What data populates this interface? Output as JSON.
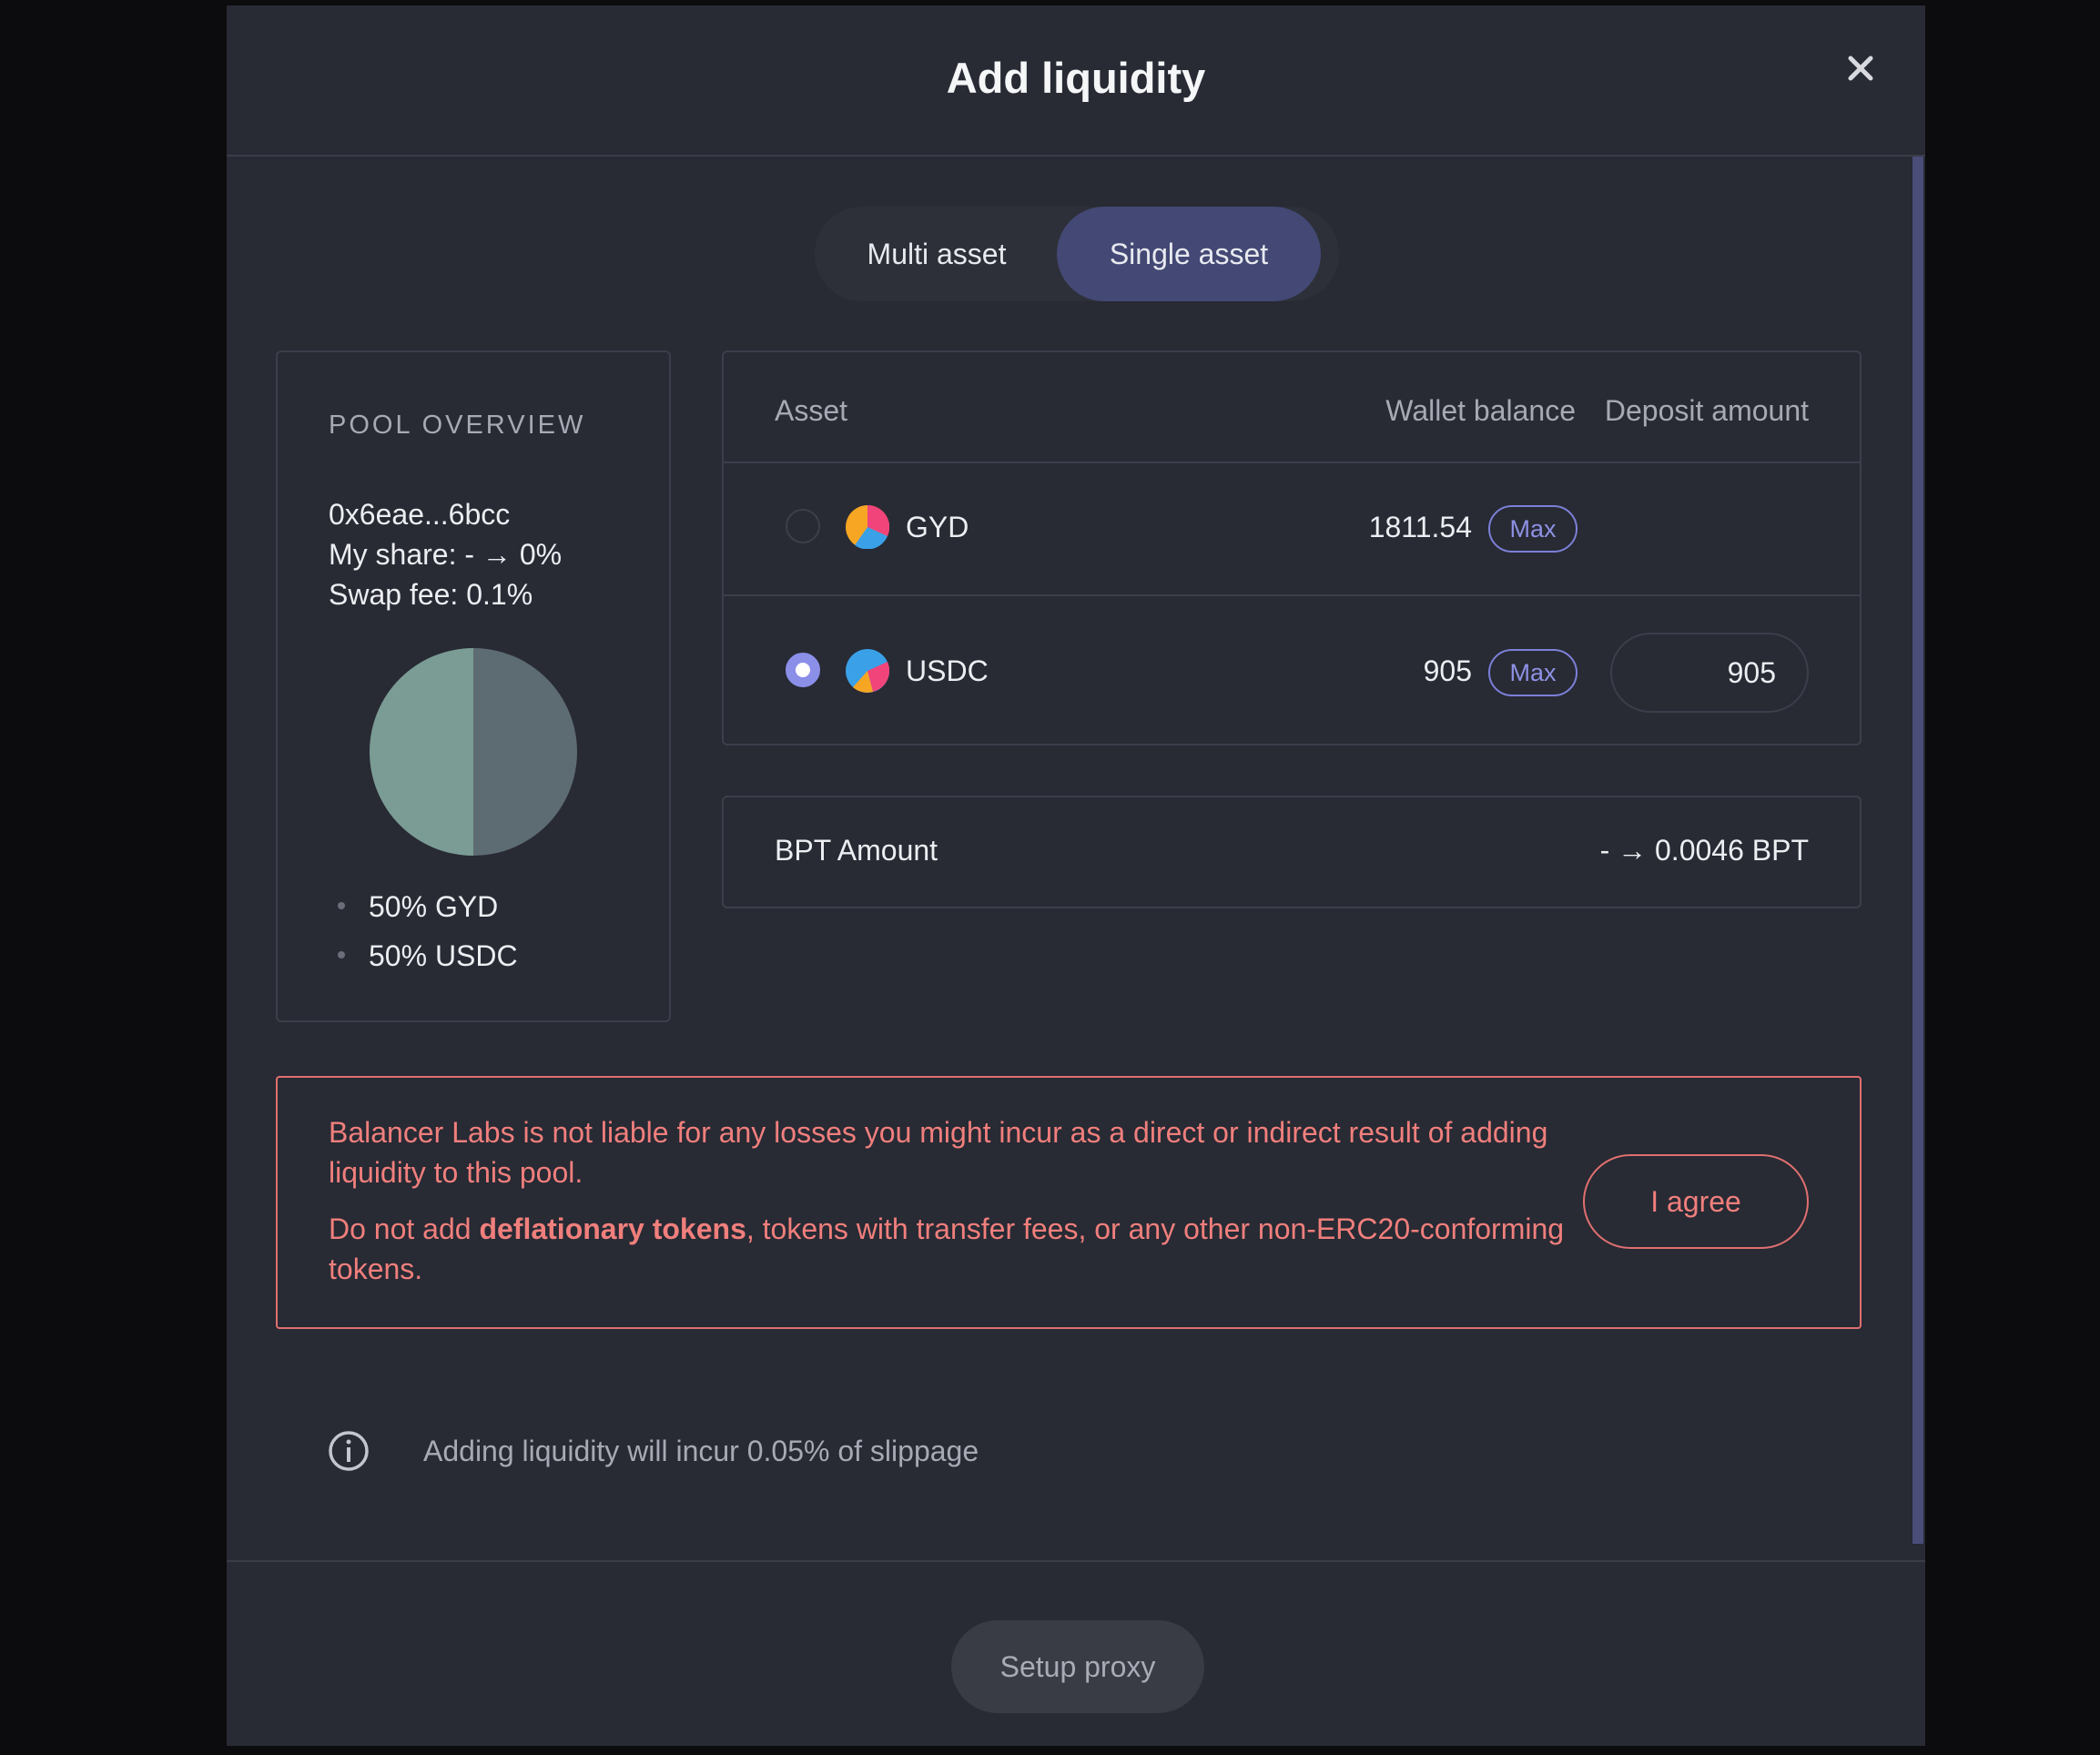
{
  "modal": {
    "title": "Add liquidity",
    "close_icon": "close-icon"
  },
  "tabs": [
    {
      "label": "Multi asset",
      "active": false
    },
    {
      "label": "Single asset",
      "active": true
    }
  ],
  "pool_overview": {
    "heading": "POOL OVERVIEW",
    "address": "0x6eae...6bcc",
    "my_share": "My share: - → 0%",
    "swap_fee": "Swap fee: 0.1%",
    "composition": [
      {
        "label": "50% GYD",
        "weight": 0.5,
        "color": "#5d6b72"
      },
      {
        "label": "50% USDC",
        "weight": 0.5,
        "color": "#7a9c94"
      }
    ]
  },
  "asset_table": {
    "headers": {
      "asset": "Asset",
      "balance": "Wallet balance",
      "deposit": "Deposit amount"
    },
    "rows": [
      {
        "symbol": "GYD",
        "balance": "1811.54",
        "max_label": "Max",
        "selected": false,
        "deposit": "",
        "icon": "gyd-token-icon"
      },
      {
        "symbol": "USDC",
        "balance": "905",
        "max_label": "Max",
        "selected": true,
        "deposit": "905",
        "icon": "usdc-token-icon"
      }
    ]
  },
  "bpt": {
    "label": "BPT Amount",
    "value": "- → 0.0046 BPT"
  },
  "warning": {
    "line1": "Balancer Labs is not liable for any losses you might incur as a direct or indirect result of adding liquidity to this pool.",
    "line2_prefix": "Do not add ",
    "line2_bold": "deflationary tokens",
    "line2_suffix": ", tokens with transfer fees, or any other non-ERC20-conforming tokens.",
    "agree_label": "I agree",
    "color": "#e0706f"
  },
  "slippage": {
    "text": "Adding liquidity will incur 0.05% of slippage",
    "icon": "info-icon"
  },
  "footer": {
    "button_label": "Setup proxy"
  },
  "colors": {
    "accent": "#8b8fe8",
    "active_tab": "#434874",
    "modal_bg": "#282a34"
  }
}
